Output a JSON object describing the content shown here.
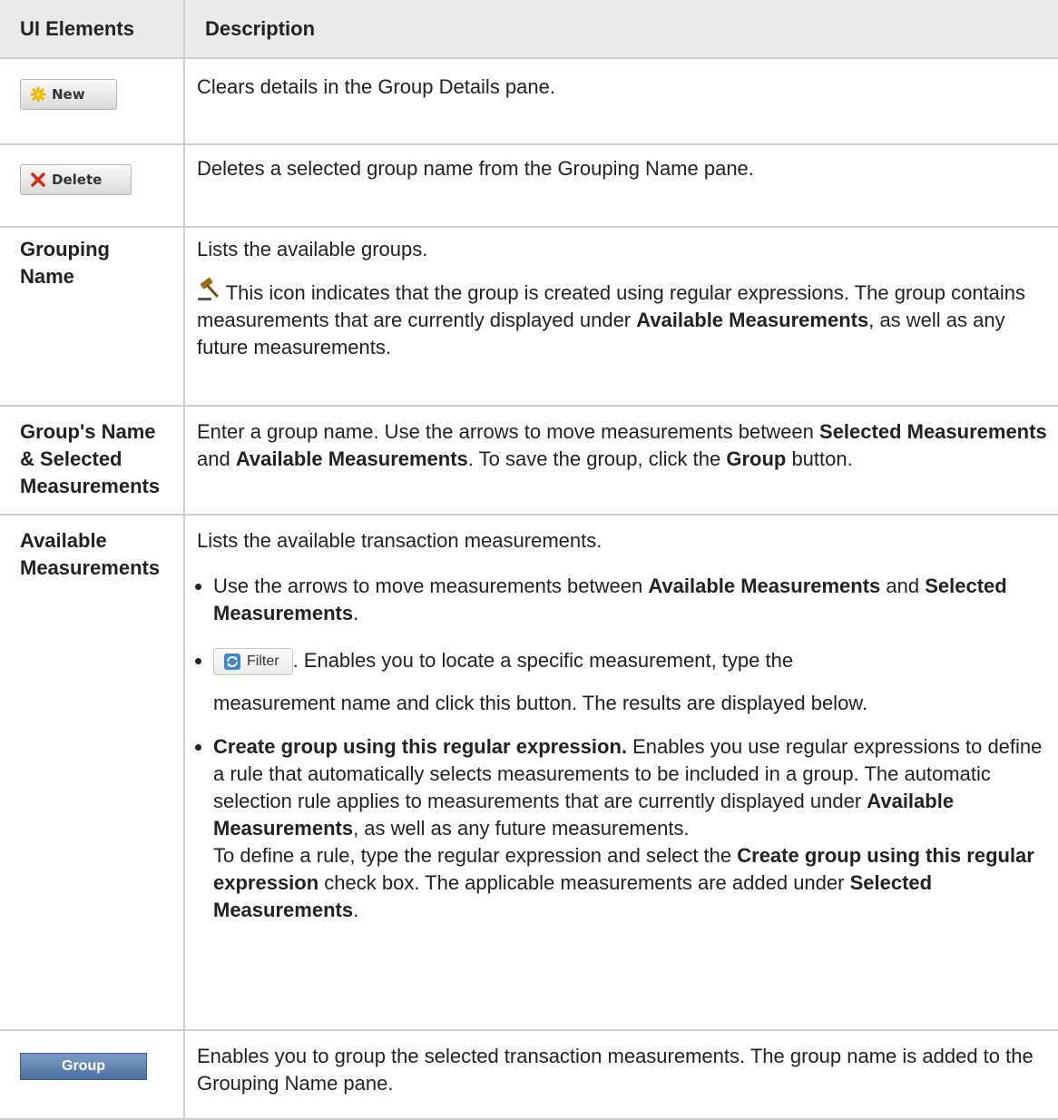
{
  "table": {
    "header": {
      "col1": "UI Elements",
      "col2": "Description"
    },
    "new_button": {
      "label": "New",
      "desc": "Clears details in the Group Details pane."
    },
    "delete_button": {
      "label": "Delete",
      "desc": "Deletes a selected group name from the Grouping Name pane."
    },
    "grouping_name": {
      "title_line1": "Grouping",
      "title_line2": "Name",
      "desc": "Lists the available groups.",
      "icon_note": " This icon indicates that the group is created using regular expressions. The group contains measurements that are currently displayed under ",
      "icon_note_bold": "Available Measurements",
      "icon_note_end": ", as well as any future measurements."
    },
    "groups_name": {
      "title_line1": "Group's Name",
      "title_line2": "& Selected",
      "title_line3": "Measurements",
      "p1": "Enter a group name. Use the arrows to move measurements between ",
      "b1": "Selected Measurements",
      "p2": " and ",
      "b2": "Available Measurements",
      "p3": ". To save the group, click the ",
      "b3": "Group",
      "p4": " button."
    },
    "available": {
      "title_line1": "Available",
      "title_line2": "Measurements",
      "desc": "Lists the available transaction measurements.",
      "bullet1_a": "Use the arrows to move measurements between ",
      "bullet1_b": "Available Measurements",
      "bullet1_c": " and ",
      "bullet1_d": "Selected Measurements",
      "bullet1_e": ".",
      "filter_label": "Filter",
      "bullet2_a": ". Enables you to locate a specific measurement, type the",
      "bullet2_b": "measurement name and click this button. The results are displayed below.",
      "bullet3_bold": "Create group using this regular expression.",
      "bullet3_a": " Enables you use regular expressions to define a rule that automatically selects measurements to be included in a group. The automatic selection rule applies to measurements that are currently displayed under ",
      "bullet3_b": "Available Measurements",
      "bullet3_c": ", as well as any future measurements.",
      "bullet3_d": "To define a rule, type the regular expression and select the ",
      "bullet3_e": "Create group using this regular expression",
      "bullet3_f": " check box. The applicable measurements are added under ",
      "bullet3_g": "Selected Measurements",
      "bullet3_h": "."
    },
    "group_button": {
      "label": "Group",
      "desc": "Enables you to group the selected transaction measurements. The group name is added to the Grouping Name pane."
    }
  }
}
